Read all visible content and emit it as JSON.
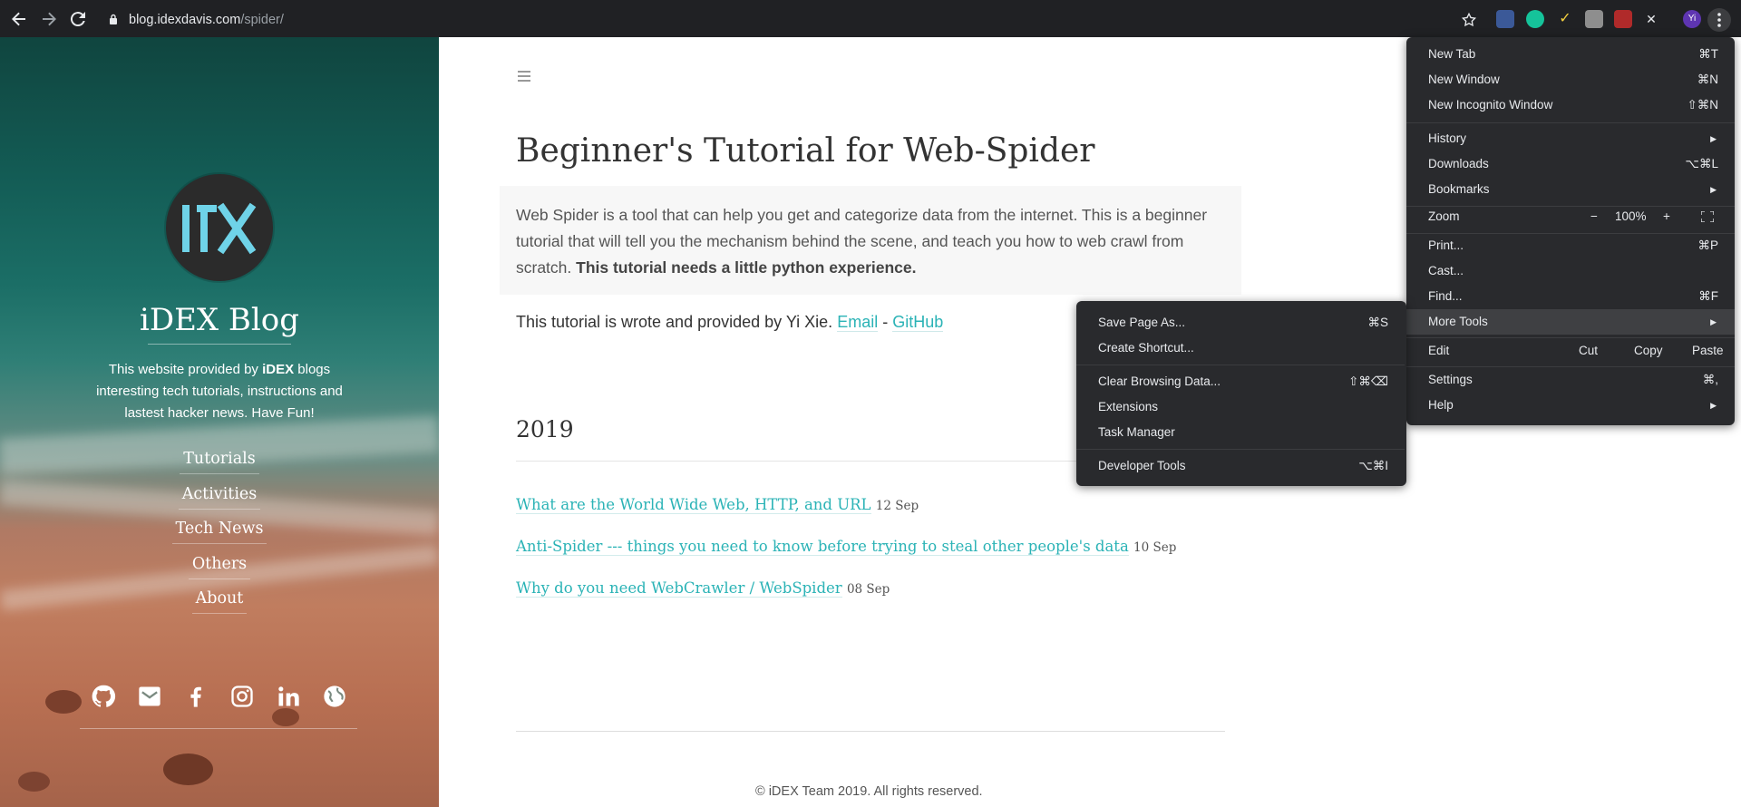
{
  "browser": {
    "url_host": "blog.idexdavis.com",
    "url_path": "/spider/",
    "colors": {
      "toolbar": "#202124",
      "menu": "#292a2d",
      "menu_highlight": "#3f4043"
    },
    "extensions": [
      "off-extension-icon",
      "grammarly-icon",
      "check-icon",
      "k-extension-icon",
      "pdf-icon",
      "x-extension-icon"
    ],
    "profile_initials": "Yi"
  },
  "sidebar": {
    "blog_title": "iDEX Blog",
    "desc_pre": "This website provided by ",
    "desc_bold": "iDEX",
    "desc_post": " blogs interesting tech tutorials, instructions and lastest hacker news. Have Fun!",
    "nav": [
      "Tutorials",
      "Activities",
      "Tech News",
      "Others",
      "About"
    ],
    "social": [
      "github-icon",
      "email-icon",
      "facebook-icon",
      "instagram-icon",
      "linkedin-icon",
      "globe-icon"
    ]
  },
  "main": {
    "title": "Beginner's Tutorial for Web-Spider",
    "intro_text": "Web Spider is a tool that can help you get and categorize data from the internet. This is a beginner tutorial that will tell you the mechanism behind the scene, and teach you how to web crawl from scratch. ",
    "intro_bold": "This tutorial needs a little python experience.",
    "credit_text": "This tutorial is wrote and provided by Yi Xie. ",
    "credit_email": "Email",
    "credit_sep": " - ",
    "credit_github": "GitHub",
    "year": "2019",
    "posts": [
      {
        "title": "What are the World Wide Web, HTTP, and URL",
        "date": "12 Sep"
      },
      {
        "title": "Anti-Spider --- things you need to know before trying to steal other people's data",
        "date": "10 Sep"
      },
      {
        "title": "Why do you need WebCrawler / WebSpider",
        "date": "08 Sep"
      }
    ],
    "copyright": "© iDEX Team 2019. All rights reserved.",
    "accent": "#2bb3b6"
  },
  "chrome_menu": {
    "new_tab": "New Tab",
    "new_tab_sc": "⌘T",
    "new_window": "New Window",
    "new_window_sc": "⌘N",
    "new_incognito": "New Incognito Window",
    "new_incognito_sc": "⇧⌘N",
    "history": "History",
    "downloads": "Downloads",
    "downloads_sc": "⌥⌘L",
    "bookmarks": "Bookmarks",
    "zoom": "Zoom",
    "zoom_minus": "−",
    "zoom_level": "100%",
    "zoom_plus": "+",
    "print": "Print...",
    "print_sc": "⌘P",
    "cast": "Cast...",
    "find": "Find...",
    "find_sc": "⌘F",
    "more_tools": "More Tools",
    "edit": "Edit",
    "cut": "Cut",
    "copy": "Copy",
    "paste": "Paste",
    "settings": "Settings",
    "settings_sc": "⌘,",
    "help": "Help"
  },
  "more_tools_menu": {
    "save_page": "Save Page As...",
    "save_page_sc": "⌘S",
    "create_shortcut": "Create Shortcut...",
    "clear_data": "Clear Browsing Data...",
    "clear_data_sc": "⇧⌘⌫",
    "extensions": "Extensions",
    "task_manager": "Task Manager",
    "dev_tools": "Developer Tools",
    "dev_tools_sc": "⌥⌘I"
  }
}
